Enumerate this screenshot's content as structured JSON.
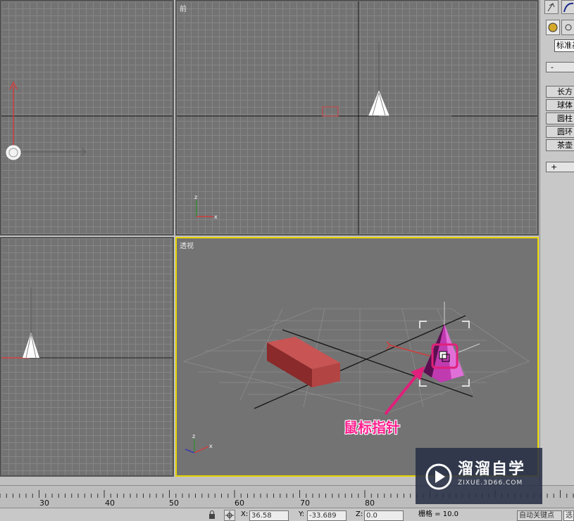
{
  "viewports": {
    "front_label": "前",
    "perspective_label": "透视"
  },
  "command_panel": {
    "dropdown_value": "标准基",
    "rollout_minus": "-",
    "buttons": [
      "长方",
      "球体",
      "圆柱",
      "圆环",
      "茶壶"
    ],
    "rollout_plus": "+"
  },
  "annotation": {
    "text": "鼠标指针",
    "color": "#ff1e8e"
  },
  "timeline": {
    "ticks": [
      "30",
      "40",
      "50",
      "60",
      "70",
      "80"
    ]
  },
  "status": {
    "x_label": "X:",
    "x_value": "36.58",
    "y_label": "Y:",
    "y_value": "-33.689",
    "z_label": "Z:",
    "z_value": "0.0",
    "grid_text": "栅格 = 10.0",
    "autokey_label": "自动关键点",
    "select_label": "选"
  },
  "watermark": {
    "title": "溜溜自学",
    "subtitle": "ZIXUE.3D66.COM"
  },
  "colors": {
    "accent_yellow": "#e8d400",
    "box_red": "#b84444",
    "cone_magenta": "#c03ab0"
  }
}
